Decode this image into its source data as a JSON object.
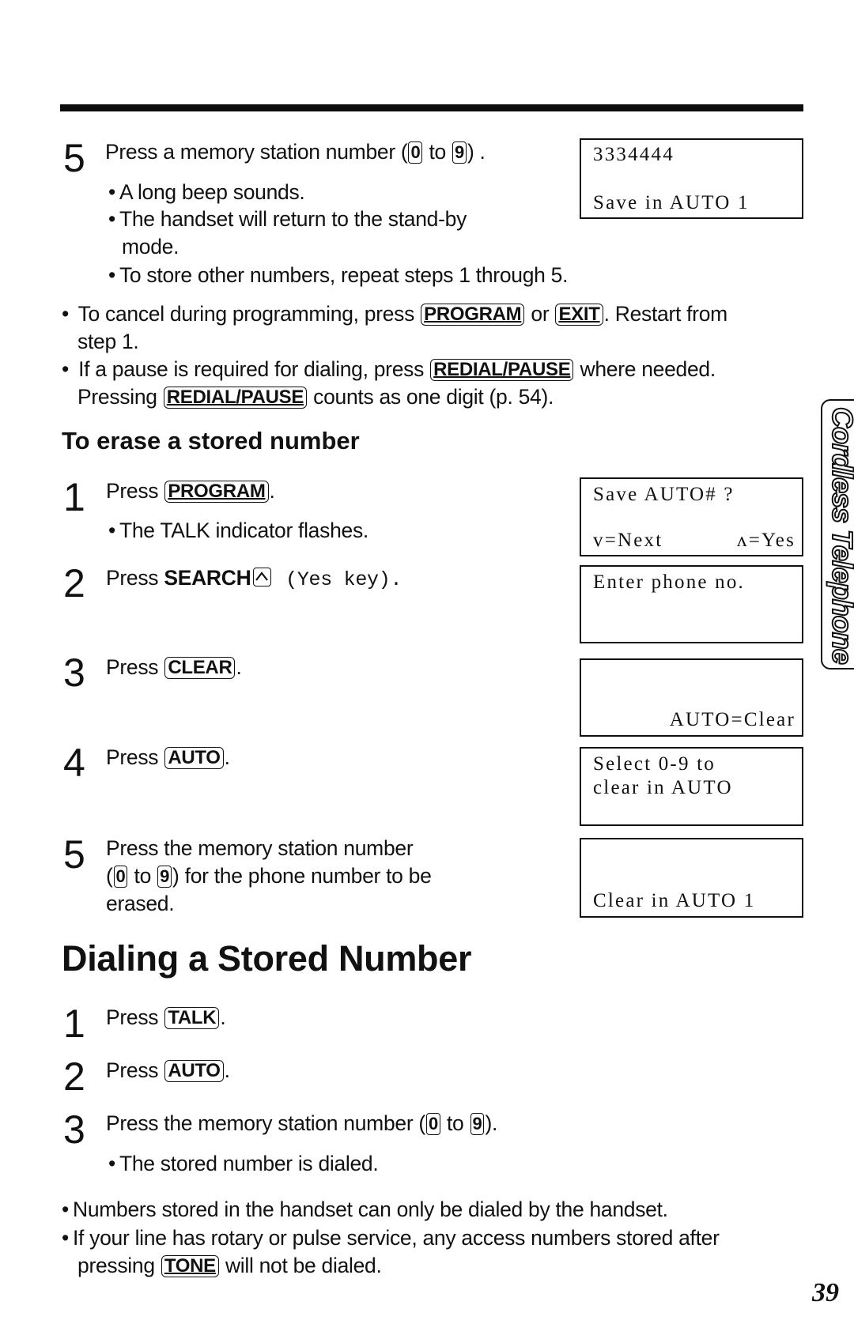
{
  "page": {
    "number": "39",
    "side_tab": "Cordless Telephone"
  },
  "store_section": {
    "step5": {
      "number": "5",
      "text_before": "Press a memory station number (",
      "key_from": "0",
      "text_mid": " to ",
      "key_to": "9",
      "text_after": ") .",
      "bullets": [
        "A long beep sounds.",
        "The handset will return to the stand-by",
        "mode.",
        "To store other numbers, repeat steps 1 through 5."
      ],
      "display": {
        "line1": "3334444",
        "line2": "Save in AUTO 1"
      }
    },
    "notes": {
      "cancel": {
        "before": "To cancel during programming, press ",
        "key1": "PROGRAM",
        "mid": " or ",
        "key2": "EXIT",
        "after": ". Restart from",
        "line2": "step 1."
      },
      "pause": {
        "before": "If a pause is required for dialing, press ",
        "key1": "REDIAL/PAUSE",
        "after": " where needed.",
        "line2_before": "Pressing ",
        "key2": "REDIAL/PAUSE",
        "line2_after": " counts as one digit (p. 54)."
      }
    }
  },
  "erase_section": {
    "heading": "To erase a stored number",
    "steps": [
      {
        "number": "1",
        "before": "Press ",
        "key": "PROGRAM",
        "after": ".",
        "bullet": "The TALK indicator flashes."
      },
      {
        "number": "2",
        "before": "Press ",
        "bold": "SEARCH",
        "icon": "up-arrow-key",
        "after": " (Yes key)."
      },
      {
        "number": "3",
        "before": "Press ",
        "key": "CLEAR",
        "after": "."
      },
      {
        "number": "4",
        "before": "Press ",
        "key": "AUTO",
        "after": "."
      },
      {
        "number": "5",
        "line1": "Press the memory station number",
        "line2_open": "(",
        "key_from": "0",
        "line2_mid": " to ",
        "key_to": "9",
        "line2_after": ") for the phone number to be",
        "line3": "erased."
      }
    ],
    "displays": [
      {
        "line1": "Save AUTO# ?",
        "line2_left": "v=Next",
        "line2_right": "ʌ=Yes"
      },
      {
        "line1": "Enter phone no."
      },
      {
        "line_bottom": "AUTO=Clear"
      },
      {
        "line1": "Select 0-9 to",
        "line2": "clear in AUTO"
      },
      {
        "line_bottom": "Clear in AUTO 1"
      }
    ]
  },
  "dial_section": {
    "heading": "Dialing a Stored Number",
    "steps": [
      {
        "number": "1",
        "before": "Press ",
        "key": "TALK",
        "after": "."
      },
      {
        "number": "2",
        "before": "Press ",
        "key": "AUTO",
        "after": "."
      },
      {
        "number": "3",
        "before": "Press the memory station number (",
        "key_from": "0",
        "mid": " to ",
        "key_to": "9",
        "after": ").",
        "bullet": "The stored number is dialed."
      }
    ],
    "notes": {
      "note1": "Numbers stored in the handset can only be dialed by the handset.",
      "note2": "If your line has rotary or pulse service, any access numbers stored after",
      "note3_before": "pressing ",
      "note3_key": "TONE",
      "note3_after": " will not be dialed."
    }
  }
}
